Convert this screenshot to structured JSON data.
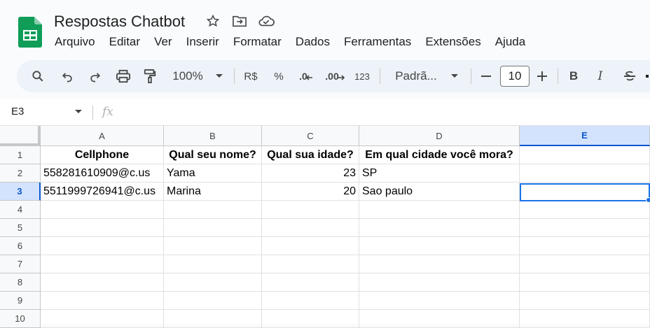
{
  "app": {
    "title": "Respostas Chatbot"
  },
  "menu": [
    "Arquivo",
    "Editar",
    "Ver",
    "Inserir",
    "Formatar",
    "Dados",
    "Ferramentas",
    "Extensões",
    "Ajuda"
  ],
  "toolbar": {
    "zoom": "100%",
    "currency": "R$",
    "percent": "%",
    "dec_less": ".0",
    "dec_more": ".00",
    "number_format": "123",
    "font_name": "Padrã...",
    "font_size": "10",
    "bold": "B",
    "italic": "I"
  },
  "formula_bar": {
    "name_box": "E3",
    "fx": "fx",
    "value": ""
  },
  "grid": {
    "columns": [
      "A",
      "B",
      "C",
      "D",
      "E"
    ],
    "selected_column": "E",
    "selected_row": 3,
    "rows": [
      "1",
      "2",
      "3",
      "4",
      "5",
      "6",
      "7",
      "8",
      "9",
      "10"
    ],
    "cells": {
      "r1": [
        "Cellphone",
        "Qual seu nome?",
        "Qual sua idade?",
        "Em qual cidade você mora?",
        ""
      ],
      "r2": [
        "558281610909@c.us",
        "Yama",
        "23",
        "SP",
        ""
      ],
      "r3": [
        "5511999726941@c.us",
        "Marina",
        "20",
        "Sao paulo",
        ""
      ]
    }
  },
  "colors": {
    "accent": "#0b57d0",
    "selection": "#1a73e8",
    "sheets_green": "#0f9d58"
  }
}
